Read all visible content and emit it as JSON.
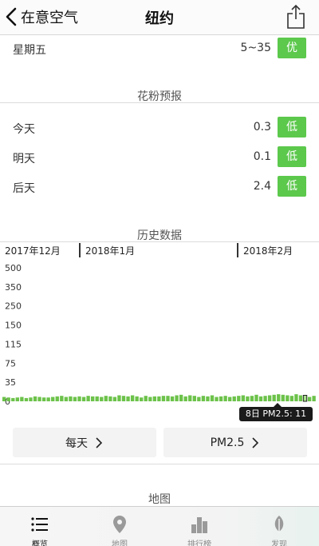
{
  "nav": {
    "back_label": "在意空气",
    "title": "纽约"
  },
  "forecast_row": {
    "label": "星期五",
    "range": "5~35",
    "badge": "优"
  },
  "pollen": {
    "header": "花粉预报",
    "rows": [
      {
        "label": "今天",
        "value": "0.3",
        "badge": "低"
      },
      {
        "label": "明天",
        "value": "0.1",
        "badge": "低"
      },
      {
        "label": "后天",
        "value": "2.4",
        "badge": "低"
      }
    ]
  },
  "history": {
    "header": "历史数据",
    "months": [
      "2017年12月",
      "2018年1月",
      "2018年2月"
    ],
    "tooltip": "8日 PM2.5: 11"
  },
  "chart_data": {
    "type": "bar",
    "y_ticks": [
      "500",
      "350",
      "250",
      "150",
      "115",
      "75",
      "35",
      "0"
    ],
    "y_tick_values": [
      500,
      350,
      250,
      150,
      115,
      75,
      35,
      0
    ],
    "values": [
      8,
      7,
      6,
      7,
      8,
      6,
      7,
      9,
      8,
      7,
      7,
      8,
      9,
      10,
      8,
      9,
      8,
      9,
      8,
      10,
      9,
      9,
      8,
      10,
      9,
      8,
      11,
      10,
      9,
      11,
      9,
      7,
      10,
      8,
      9,
      9,
      10,
      10,
      9,
      11,
      12,
      9,
      11,
      10,
      8,
      10,
      9,
      11,
      8,
      9,
      10,
      8,
      9,
      10,
      11,
      9,
      10,
      12,
      9,
      10,
      11,
      12,
      13,
      12,
      11,
      10,
      13,
      11,
      11,
      8,
      10
    ],
    "highlight_index": 68,
    "bar_color": "#6cc24a",
    "highlight_color": "#a8e08c"
  },
  "buttons": {
    "period": "每天",
    "metric": "PM2.5"
  },
  "map_header": "地图",
  "tabs": [
    {
      "label": "概览",
      "icon": "list-icon"
    },
    {
      "label": "地图",
      "icon": "map-pin-icon"
    },
    {
      "label": "排行榜",
      "icon": "bar-chart-icon"
    },
    {
      "label": "发现",
      "icon": "leaf-icon"
    }
  ],
  "colors": {
    "good": "#5cc84c"
  }
}
